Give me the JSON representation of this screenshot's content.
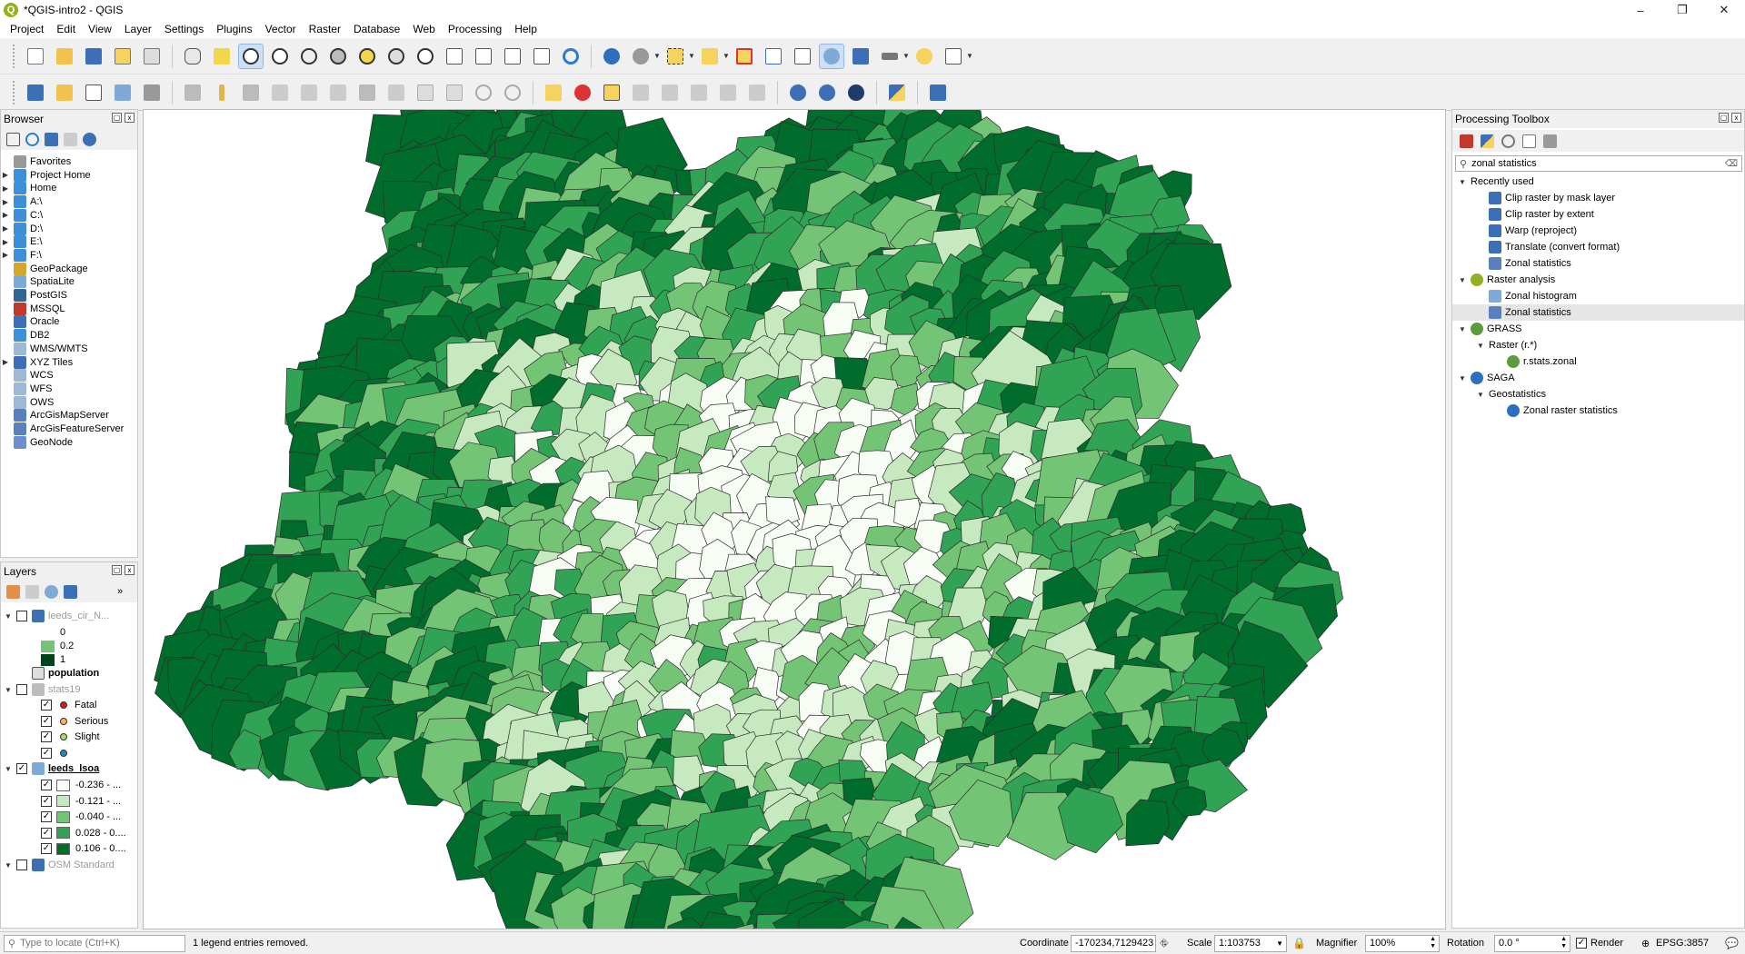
{
  "window": {
    "title": "*QGIS-intro2 - QGIS",
    "logo_letter": "Q",
    "min": "–",
    "max": "❐",
    "close": "✕"
  },
  "menu": [
    "Project",
    "Edit",
    "View",
    "Layer",
    "Settings",
    "Plugins",
    "Vector",
    "Raster",
    "Database",
    "Web",
    "Processing",
    "Help"
  ],
  "colors": {
    "accent": "#93b023",
    "map_d1": "#f7fcf5",
    "map_d2": "#c7e9c0",
    "map_d3": "#74c476",
    "map_d4": "#31a354",
    "map_d5": "#006d2c"
  },
  "browser": {
    "title": "Browser",
    "items": [
      {
        "label": "Favorites",
        "icon": "star-icon",
        "arrow": ""
      },
      {
        "label": "Project Home",
        "icon": "folder-icon",
        "arrow": "▶"
      },
      {
        "label": "Home",
        "icon": "folder-icon",
        "arrow": "▶"
      },
      {
        "label": "A:\\",
        "icon": "drive-icon",
        "arrow": "▶"
      },
      {
        "label": "C:\\",
        "icon": "drive-icon",
        "arrow": "▶"
      },
      {
        "label": "D:\\",
        "icon": "drive-icon",
        "arrow": "▶"
      },
      {
        "label": "E:\\",
        "icon": "drive-icon",
        "arrow": "▶"
      },
      {
        "label": "F:\\",
        "icon": "drive-icon",
        "arrow": "▶"
      },
      {
        "label": "GeoPackage",
        "icon": "geopackage-icon",
        "arrow": ""
      },
      {
        "label": "SpatiaLite",
        "icon": "spatialite-icon",
        "arrow": ""
      },
      {
        "label": "PostGIS",
        "icon": "postgis-icon",
        "arrow": ""
      },
      {
        "label": "MSSQL",
        "icon": "mssql-icon",
        "arrow": ""
      },
      {
        "label": "Oracle",
        "icon": "oracle-icon",
        "arrow": ""
      },
      {
        "label": "DB2",
        "icon": "db2-icon",
        "arrow": ""
      },
      {
        "label": "WMS/WMTS",
        "icon": "globe-icon",
        "arrow": ""
      },
      {
        "label": "XYZ Tiles",
        "icon": "tiles-icon",
        "arrow": "▶"
      },
      {
        "label": "WCS",
        "icon": "globe-icon",
        "arrow": ""
      },
      {
        "label": "WFS",
        "icon": "globe-icon",
        "arrow": ""
      },
      {
        "label": "OWS",
        "icon": "globe-icon",
        "arrow": ""
      },
      {
        "label": "ArcGisMapServer",
        "icon": "arcgis-icon",
        "arrow": ""
      },
      {
        "label": "ArcGisFeatureServer",
        "icon": "arcgis-icon",
        "arrow": ""
      },
      {
        "label": "GeoNode",
        "icon": "geonode-icon",
        "arrow": ""
      }
    ]
  },
  "layers": {
    "title": "Layers",
    "more": "»",
    "rows": [
      {
        "kind": "layer",
        "label": "leeds_cir_N...",
        "arrow": "▼",
        "checked": false,
        "grey": true,
        "icon": "raster-icon"
      },
      {
        "kind": "legend",
        "label": "0",
        "color": "#ffffff",
        "indent": 1
      },
      {
        "kind": "legend",
        "label": "0.2",
        "color": "#74c476",
        "indent": 1
      },
      {
        "kind": "legend",
        "label": "1",
        "color": "#00441b",
        "indent": 1
      },
      {
        "kind": "layer",
        "label": "population",
        "arrow": "",
        "checked": null,
        "bold": true,
        "icon": "table-icon"
      },
      {
        "kind": "layer",
        "label": "stats19",
        "arrow": "▼",
        "checked": false,
        "grey": true,
        "icon": "points-icon"
      },
      {
        "kind": "cat",
        "label": "Fatal",
        "dot": "#d7191c"
      },
      {
        "kind": "cat",
        "label": "Serious",
        "dot": "#fdae61"
      },
      {
        "kind": "cat",
        "label": "Slight",
        "dot": "#a6d96a"
      },
      {
        "kind": "cat",
        "label": "",
        "dot": "#2b83ba"
      },
      {
        "kind": "layer",
        "label": "leeds_lsoa",
        "arrow": "▼",
        "checked": true,
        "bold": true,
        "underline": true,
        "icon": "polygon-icon"
      },
      {
        "kind": "catsw",
        "label": "-0.236 - ...",
        "color": "#f7fcf5"
      },
      {
        "kind": "catsw",
        "label": "-0.121 - ...",
        "color": "#c7e9c0"
      },
      {
        "kind": "catsw",
        "label": "-0.040 - ...",
        "color": "#74c476"
      },
      {
        "kind": "catsw",
        "label": "0.028 - 0....",
        "color": "#31a354"
      },
      {
        "kind": "catsw",
        "label": "0.106 - 0....",
        "color": "#006d2c"
      },
      {
        "kind": "layer",
        "label": "OSM Standard",
        "arrow": "▼",
        "checked": false,
        "grey": true,
        "icon": "tiles-icon"
      }
    ]
  },
  "processing": {
    "title": "Processing Toolbox",
    "search": "zonal statistics",
    "tree": [
      {
        "label": "Recently used",
        "level": 0,
        "arrow": "▼",
        "icon": ""
      },
      {
        "label": "Clip raster by mask layer",
        "level": 1,
        "arrow": "",
        "icon": "gdal-icon"
      },
      {
        "label": "Clip raster by extent",
        "level": 1,
        "arrow": "",
        "icon": "gdal-icon"
      },
      {
        "label": "Warp (reproject)",
        "level": 1,
        "arrow": "",
        "icon": "gdal-icon"
      },
      {
        "label": "Translate (convert format)",
        "level": 1,
        "arrow": "",
        "icon": "gdal-icon"
      },
      {
        "label": "Zonal statistics",
        "level": 1,
        "arrow": "",
        "icon": "zonal-icon"
      },
      {
        "label": "Raster analysis",
        "level": 0,
        "arrow": "▼",
        "icon": "qgis-icon"
      },
      {
        "label": "Zonal histogram",
        "level": 1,
        "arrow": "",
        "icon": "gear-icon"
      },
      {
        "label": "Zonal statistics",
        "level": 1,
        "arrow": "",
        "icon": "zonal-icon",
        "selected": true
      },
      {
        "label": "GRASS",
        "level": 0,
        "arrow": "▼",
        "icon": "grass-icon"
      },
      {
        "label": "Raster (r.*)",
        "level": 1,
        "arrow": "▼",
        "icon": ""
      },
      {
        "label": "r.stats.zonal",
        "level": 2,
        "arrow": "",
        "icon": "grass-icon"
      },
      {
        "label": "SAGA",
        "level": 0,
        "arrow": "▼",
        "icon": "saga-icon"
      },
      {
        "label": "Geostatistics",
        "level": 1,
        "arrow": "▼",
        "icon": ""
      },
      {
        "label": "Zonal raster statistics",
        "level": 2,
        "arrow": "",
        "icon": "saga-icon"
      }
    ]
  },
  "status": {
    "locate_placeholder": "Type to locate (Ctrl+K)",
    "message": "1 legend entries removed.",
    "coordinate_label": "Coordinate",
    "coordinate": "-170234,7129423",
    "scale_label": "Scale",
    "scale": "1:103753",
    "magnifier_label": "Magnifier",
    "magnifier": "100%",
    "rotation_label": "Rotation",
    "rotation": "0.0 °",
    "render_label": "Render",
    "crs": "EPSG:3857"
  }
}
